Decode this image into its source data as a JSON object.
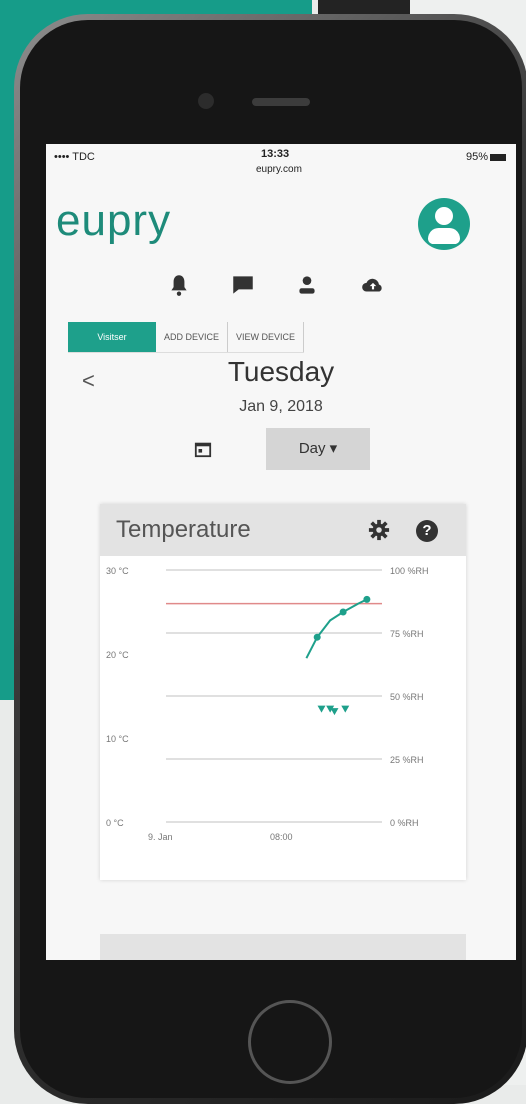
{
  "status_bar": {
    "carrier": "•••• TDC",
    "time": "13:33",
    "url": "eupry.com",
    "battery": "95%"
  },
  "header": {
    "logo_text": "eupry",
    "avatar_icon": "user-circle-icon"
  },
  "nav_icons": [
    "bell-icon",
    "chat-icon",
    "user-icon",
    "cloud-upload-icon"
  ],
  "tabs": [
    {
      "label": "Visitser",
      "active": true
    },
    {
      "label": "ADD DEVICE",
      "active": false
    },
    {
      "label": "VIEW DEVICE",
      "active": false
    }
  ],
  "date_nav": {
    "back": "<",
    "day": "Tuesday",
    "date": "Jan 9, 2018",
    "period": "Day ▾"
  },
  "card": {
    "title": "Temperature",
    "settings_icon": "gear-icon",
    "help_icon": "help-icon",
    "help_glyph": "?"
  },
  "colors": {
    "brand": "#1ea08b",
    "background_teal": "#169c89",
    "threshold": "#e08a8a"
  },
  "chart_data": {
    "type": "line",
    "title": "Temperature",
    "y_left": {
      "ticks": [
        "30 °C",
        "20 °C",
        "10 °C",
        "0 °C"
      ],
      "range": [
        0,
        30
      ]
    },
    "y_right": {
      "ticks": [
        "100 %RH",
        "75 %RH",
        "50 %RH",
        "25 %RH",
        "0 %RH"
      ],
      "range": [
        0,
        100
      ]
    },
    "x_ticks": [
      "9. Jan",
      "08:00"
    ],
    "threshold_temperature": 26,
    "series": [
      {
        "values": [
          {
            "x": 0.65,
            "y": 19.5
          },
          {
            "x": 0.7,
            "y": 22
          },
          {
            "x": 0.76,
            "y": 24
          },
          {
            "x": 0.82,
            "y": 25
          },
          {
            "x": 0.89,
            "y": 26
          },
          {
            "x": 0.93,
            "y": 26.5
          }
        ]
      },
      {
        "values": [
          {
            "x": 0.72,
            "y": 45
          },
          {
            "x": 0.76,
            "y": 45
          },
          {
            "x": 0.78,
            "y": 44
          },
          {
            "x": 0.83,
            "y": 45
          }
        ]
      }
    ],
    "grid": true
  }
}
